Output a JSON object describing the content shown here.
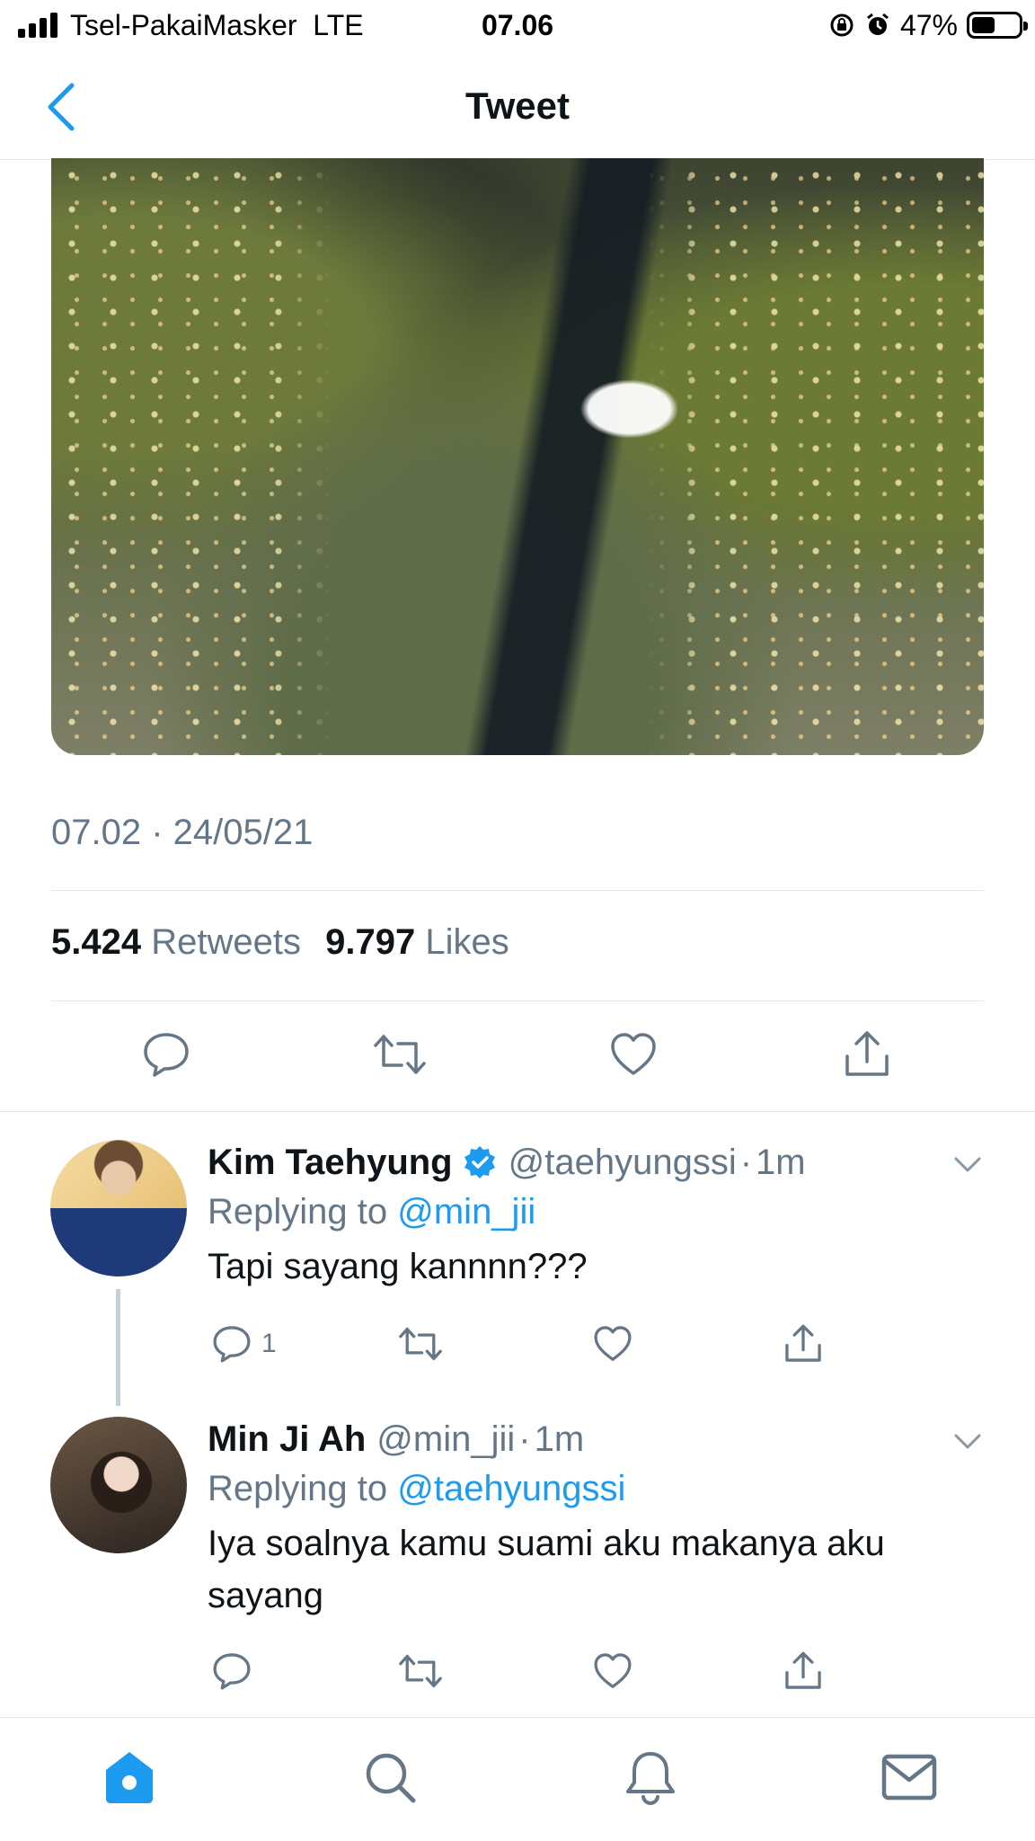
{
  "status_bar": {
    "carrier": "Tsel-PakaiMasker",
    "network": "LTE",
    "time": "07.06",
    "battery": "47%",
    "battery_level": 0.47,
    "icons": [
      "signal-bars",
      "rotation-lock-icon",
      "alarm-icon",
      "battery-icon"
    ]
  },
  "nav": {
    "title": "Tweet",
    "back_icon": "chevron-left-icon"
  },
  "tweet": {
    "timestamp": "07.02 · 24/05/21",
    "retweets_count": "5.424",
    "retweets_label": "Retweets",
    "likes_count": "9.797",
    "likes_label": "Likes",
    "actions": [
      "reply-icon",
      "retweet-icon",
      "like-icon",
      "share-icon"
    ]
  },
  "replies": [
    {
      "name": "Kim Taehyung",
      "verified": true,
      "handle": "@taehyungssi",
      "separator": "·",
      "time": "1m",
      "replying_prefix": "Replying to",
      "replying_to": "@min_jii",
      "text": "Tapi sayang kannnn???",
      "reply_count": "1"
    },
    {
      "name": "Min Ji Ah",
      "verified": false,
      "handle": "@min_jii",
      "separator": "·",
      "time": "1m",
      "replying_prefix": "Replying to",
      "replying_to": "@taehyungssi",
      "text": "Iya soalnya kamu suami aku makanya aku sayang",
      "reply_count": ""
    }
  ],
  "tab_bar": {
    "tabs": [
      "home-icon",
      "search-icon",
      "notifications-icon",
      "messages-icon"
    ],
    "active": "home-icon"
  },
  "colors": {
    "accent": "#1d9bf0",
    "text_primary": "#0f1419",
    "text_secondary": "#657786",
    "divider": "#e1e8ed"
  }
}
